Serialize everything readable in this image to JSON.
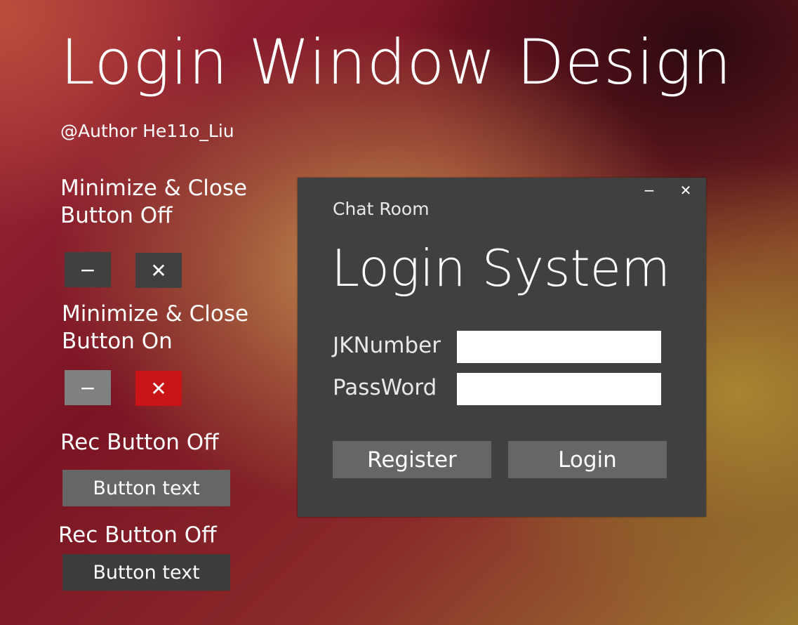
{
  "page": {
    "title": "Login Window Design",
    "author": "@Author He11o_Liu"
  },
  "demo": {
    "min_close_off_label_line1": "Minimize & Close",
    "min_close_off_label_line2": "Button Off",
    "min_close_on_label_line1": "Minimize & Close",
    "min_close_on_label_line2": "Button On",
    "minimize_glyph": "−",
    "close_glyph": "✕",
    "rec_off_label_1": "Rec Button Off",
    "rec_off_label_2": "Rec Button Off",
    "rec_button_text_1": "Button text",
    "rec_button_text_2": "Button text",
    "colors": {
      "button_off": "#404040",
      "minimize_on": "#808080",
      "close_on": "#c81414",
      "rec_off_1": "#666666",
      "rec_off_2": "#3c3c3c"
    }
  },
  "window": {
    "app_name": "Chat Room",
    "title": "Login System",
    "minimize_glyph": "−",
    "close_glyph": "✕",
    "fields": {
      "jknumber_label": "JKNumber",
      "jknumber_value": "",
      "password_label": "PassWord",
      "password_value": ""
    },
    "register_label": "Register",
    "login_label": "Login",
    "colors": {
      "background": "#404040",
      "button": "#666666",
      "input": "#ffffff"
    }
  }
}
